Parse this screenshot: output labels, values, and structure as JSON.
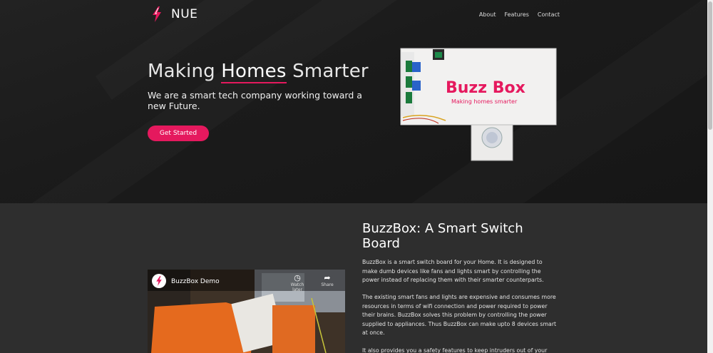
{
  "nav": {
    "brand": "NUE",
    "links": [
      "About",
      "Features",
      "Contact"
    ]
  },
  "hero": {
    "title_pre": "Making ",
    "title_highlight": "Homes",
    "title_post": " Smarter",
    "subtitle": "We are a smart tech company working toward a new Future.",
    "cta_label": "Get Started"
  },
  "product_image": {
    "logo_text": "Buzz Box",
    "tagline": "Making homes smarter"
  },
  "video": {
    "title": "BuzzBox Demo",
    "actions": [
      {
        "icon": "clock-icon",
        "label": "Watch later"
      },
      {
        "icon": "share-icon",
        "label": "Share"
      }
    ]
  },
  "section": {
    "title": "BuzzBox: A Smart Switch Board",
    "paragraphs": [
      "BuzzBox is a smart switch board for your Home. It is designed to make dumb devices like fans and lights smart by controlling the power instead of replacing them with their smarter counterparts.",
      "The existing smart fans and lights are expensive and consumes more resources in terms of wifi connection and power required to power their brains. BuzzBox solves this problem by controlling the power supplied to appliances. Thus BuzzBox can make upto 8 devices smart at once.",
      "It also provides you a safety features to keep intruders out of your"
    ]
  },
  "colors": {
    "accent": "#e5195e",
    "hero_bg": "#1c1c1c",
    "content_bg": "#2e2e2e"
  }
}
